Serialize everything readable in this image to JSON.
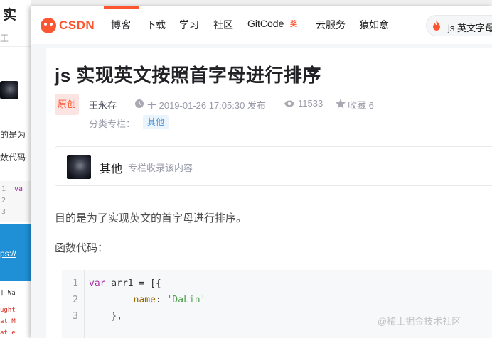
{
  "background_window": {
    "title": "实",
    "sub1": "王",
    "line1": "的是为",
    "line2": "数代码",
    "code_lines": [
      "1",
      "2",
      "3"
    ],
    "code_start": "va",
    "link": "ps://",
    "console": [
      {
        "text": "] Wa",
        "color": "#333333"
      },
      {
        "text": "ught",
        "color": "#d93025"
      },
      {
        "text": "at M",
        "color": "#d93025"
      },
      {
        "text": "at e",
        "color": "#d93025"
      }
    ]
  },
  "nav": {
    "logo_text": "CSDN",
    "items": [
      {
        "label": "博客",
        "active": true
      },
      {
        "label": "下载"
      },
      {
        "label": "学习"
      },
      {
        "label": "社区"
      },
      {
        "label": "GitCode"
      },
      {
        "label": "云服务"
      },
      {
        "label": "猿如意"
      }
    ],
    "gitcode_badge": "奖",
    "search_text": "js 英文字母",
    "accent_color": "#fc5531"
  },
  "article": {
    "title": "js 实现英文按照首字母进行排序",
    "original_badge": "原创",
    "author": "王永存",
    "date": "于 2019-01-26 17:05:30 发布",
    "views": "11533",
    "favorites": "收藏 6",
    "category_label": "分类专栏：",
    "category_tag": "其他",
    "column": {
      "name": "其他",
      "desc": "专栏收录该内容"
    },
    "paragraphs": [
      "目的是为了实现英文的首字母进行排序。",
      "函数代码："
    ],
    "code": {
      "line_numbers": [
        "1",
        "2",
        "3"
      ],
      "lines": [
        {
          "k": "var",
          "rest": " arr1 = [{"
        },
        {
          "indent": "        ",
          "prop": "name",
          "colon": ": ",
          "str": "'DaLin'",
          "tail": ""
        },
        {
          "plain": "    },"
        }
      ]
    }
  },
  "watermark": "@稀土掘金技术社区"
}
